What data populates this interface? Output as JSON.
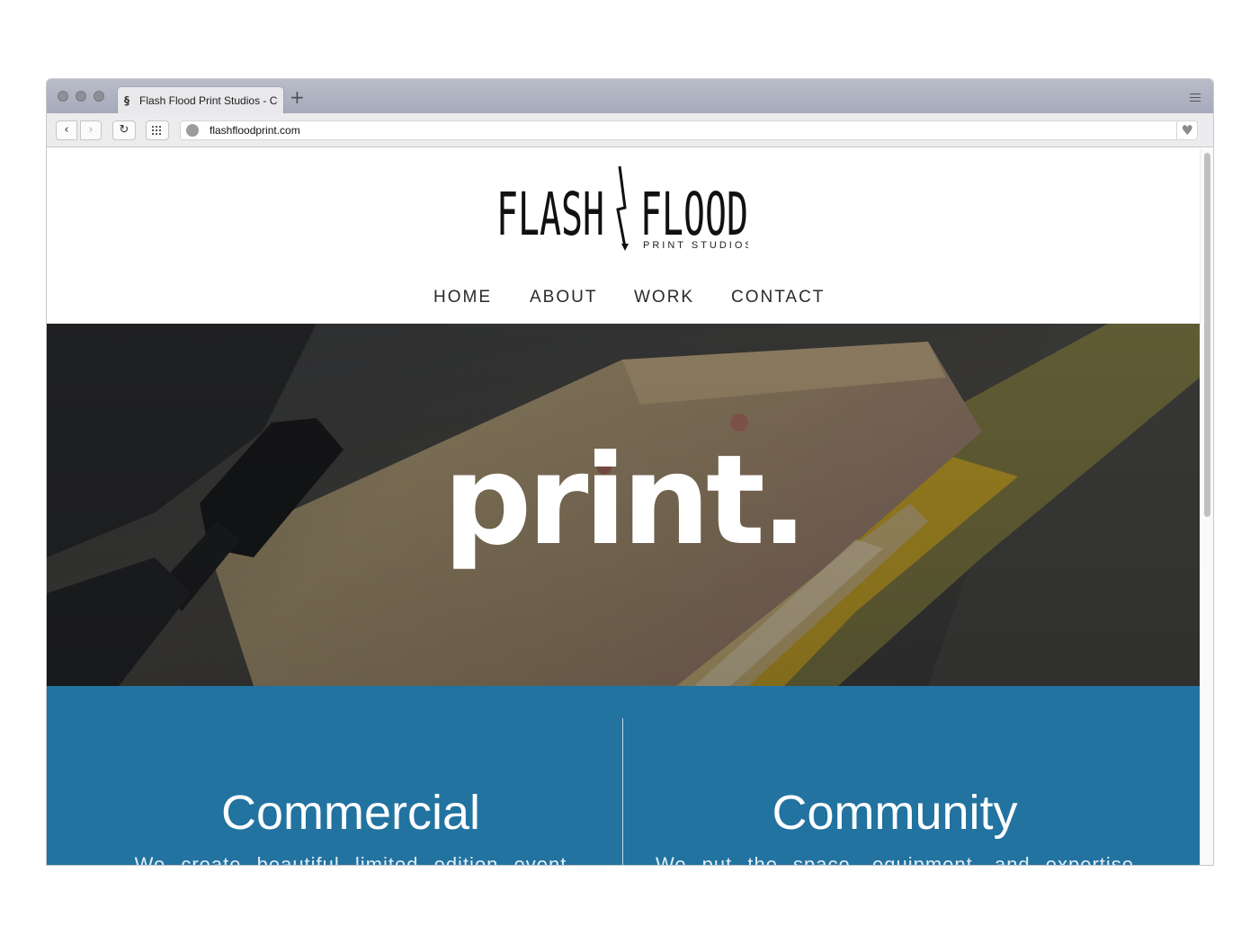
{
  "browser": {
    "tab_title": "Flash Flood Print Studios - Co",
    "new_tab_symbol": "+",
    "url": "flashfloodprint.com",
    "back_symbol": "‹",
    "forward_symbol": "›",
    "reload_symbol": "↻",
    "heart_symbol": "♥",
    "favicon_symbol": "§"
  },
  "site": {
    "logo": {
      "word1": "FLASH",
      "word2": "FLOOD",
      "tagline": "PRINT STUDIOS"
    },
    "nav": [
      "HOME",
      "ABOUT",
      "WORK",
      "CONTACT"
    ],
    "active_nav": "HOME",
    "hero": {
      "headline": "print."
    },
    "sections": [
      {
        "title": "Commercial",
        "body": "We create beautiful limited edition event"
      },
      {
        "title": "Community",
        "body": "We put the space, equipment, and expertise"
      }
    ]
  },
  "colors": {
    "accent_blue": "#2273a0",
    "nav_underline": "#2e87c5",
    "hero_text": "#ffffff"
  },
  "icons": [
    "favicon-icon",
    "back-icon",
    "forward-icon",
    "reload-icon",
    "tabs-grid-icon",
    "globe-icon",
    "heart-icon",
    "menu-icon",
    "plus-icon",
    "lightning-bolt-icon"
  ]
}
